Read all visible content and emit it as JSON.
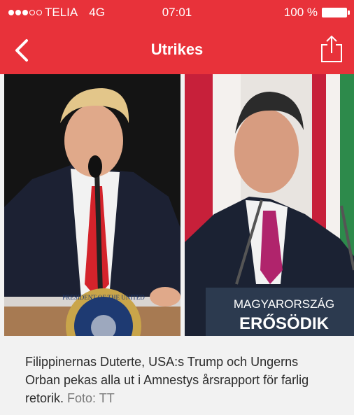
{
  "status_bar": {
    "carrier": "TELIA",
    "network": "4G",
    "time": "07:01",
    "battery": "100 %",
    "signal_bars": 5,
    "signal_filled": 3
  },
  "nav": {
    "title": "Utrikes",
    "back_icon": "chevron-left-icon",
    "share_icon": "share-icon"
  },
  "photo": {
    "seal_text": "PRESIDENT OF THE UNITED",
    "sign_line1": "MAGYARORSZÁG",
    "sign_line2": "ERŐSÖDIK"
  },
  "caption": {
    "text": "Filippinernas Duterte, USA:s Trump och Ungerns Orban pekas alla ut i Amnestys årsrapport för farlig retorik.",
    "credit": "Foto: TT"
  },
  "colors": {
    "brand": "#e8323a",
    "caption_bg": "#f2f2f2"
  }
}
